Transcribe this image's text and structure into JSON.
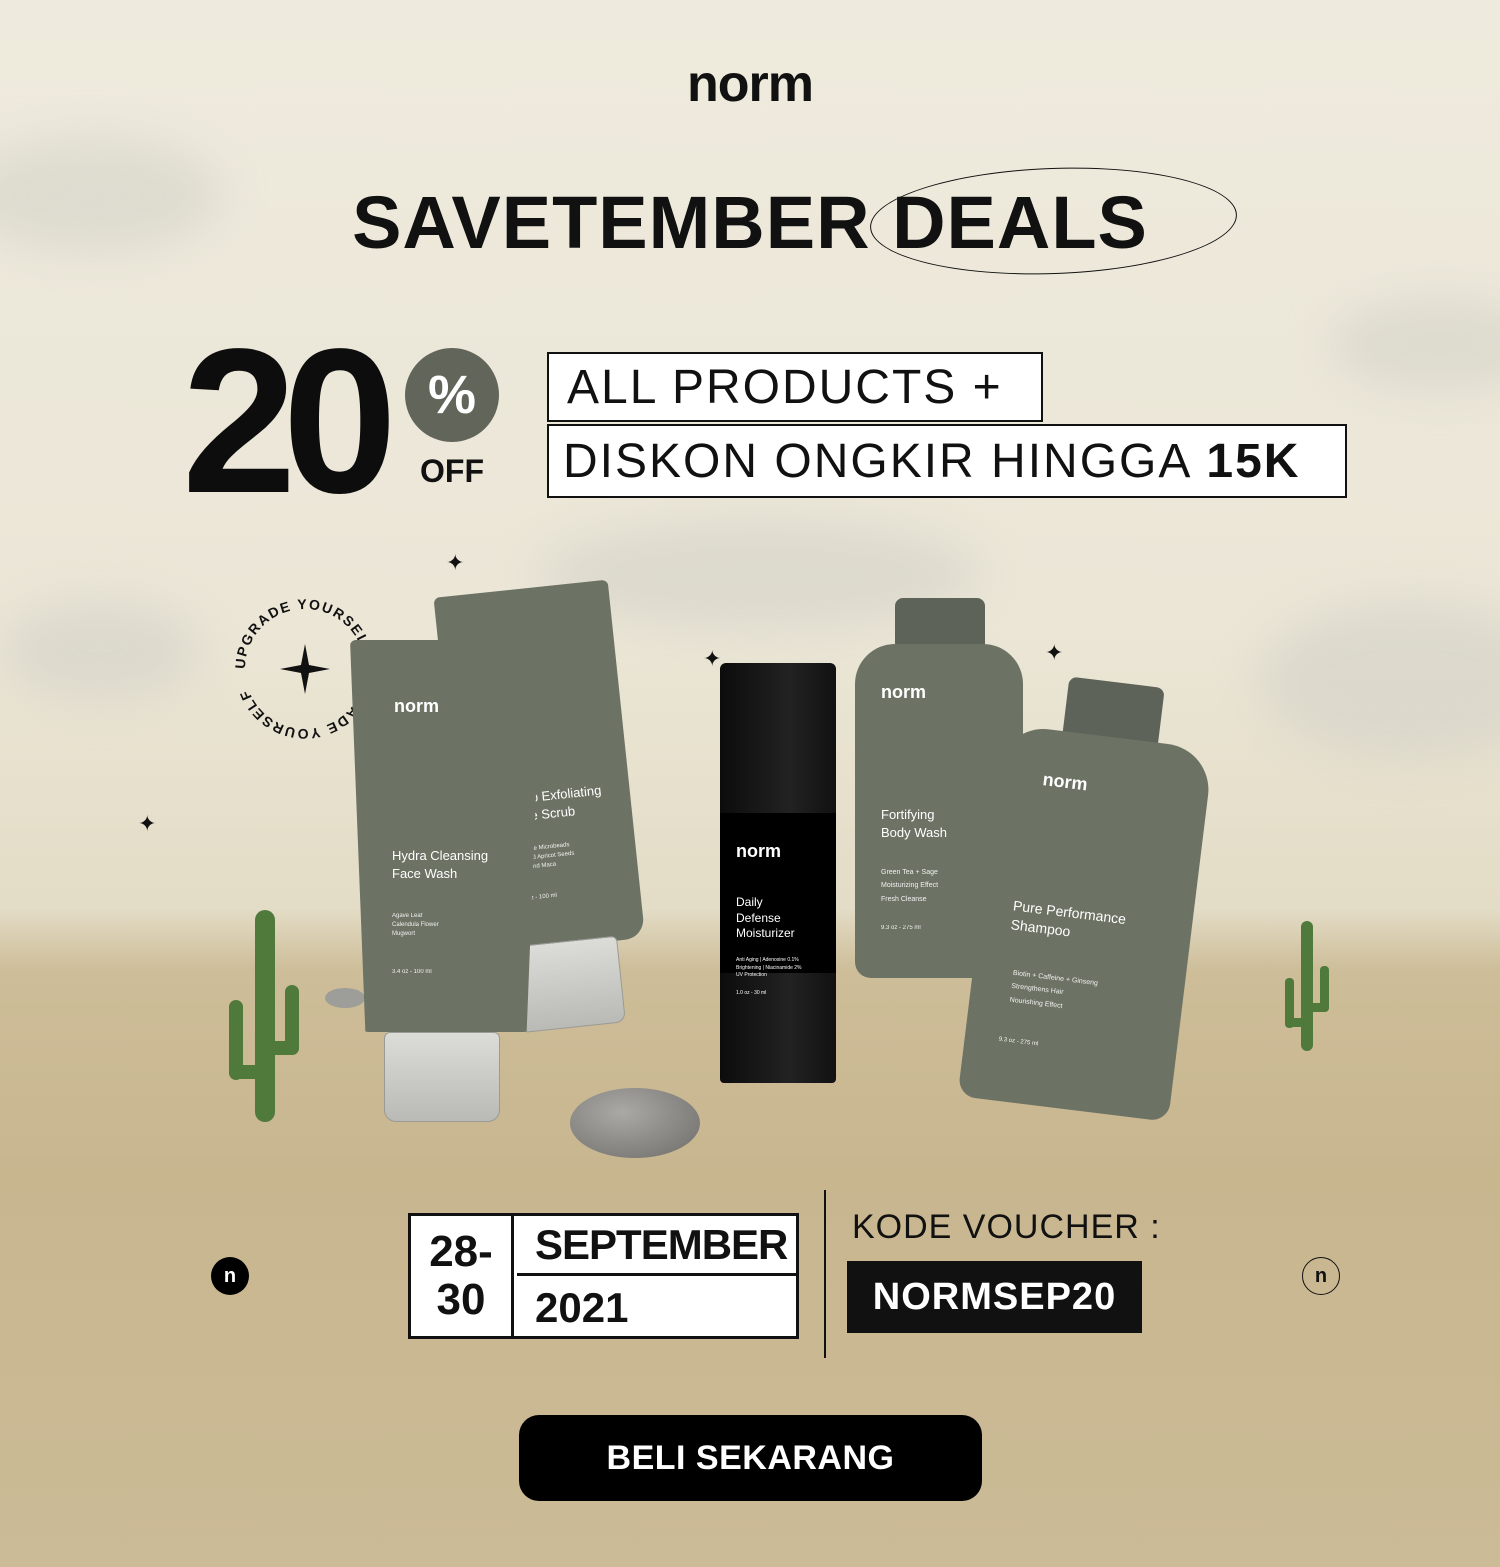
{
  "brand": {
    "logo": "norm"
  },
  "headline": "SAVETEMBER DEALS",
  "discount": {
    "number": "20",
    "percent": "%",
    "off": "OFF"
  },
  "offer": {
    "line1": "ALL PRODUCTS +",
    "line2_text": "DISKON ONGKIR HINGGA",
    "line2_bold": "15K"
  },
  "stamp": {
    "text": "UPGRADE YOURSELF  UPGRADE YOURSELF  "
  },
  "products": {
    "face_wash": {
      "brand": "norm",
      "name": "Hydra Cleansing\nFace Wash",
      "ingredients": "Agave Leaf\nCalendula Flower\nMugwort",
      "size": "3.4 oz - 100 ml"
    },
    "face_scrub": {
      "brand": "norm",
      "name": "Deep Exfoliating\nFace Scrub",
      "ingredients": "Cellulose Microbeads\nCrushed Apricot Seeds\nSage and Maca",
      "size": "3.4 oz - 100 ml"
    },
    "moisturizer": {
      "brand": "norm",
      "name": "Daily\nDefense\nMoisturizer",
      "ingredients": "Anti Aging | Adenosine 0.1%\nBrightening | Niacinamide 2%\nUV Protection",
      "size": "1.0 oz - 30 ml"
    },
    "body_wash": {
      "brand": "norm",
      "name": "Fortifying\nBody Wash",
      "ingredients": "Green Tea + Sage\nMoisturizing Effect\nFresh Cleanse",
      "size": "9.3 oz - 275 ml"
    },
    "shampoo": {
      "brand": "norm",
      "name": "Pure Performance\nShampoo",
      "ingredients": "Biotin + Caffeine + Ginseng\nStrengthens Hair\nNourishing Effect",
      "size": "9.3 oz - 275 ml"
    }
  },
  "date": {
    "days": "28-\n30",
    "month": "SEPTEMBER",
    "year": "2021"
  },
  "voucher": {
    "label": "KODE VOUCHER :",
    "code": "NORMSEP20"
  },
  "badges": {
    "left": "n",
    "right": "n"
  },
  "cta": {
    "label": "BELI SEKARANG"
  },
  "colors": {
    "product_green": "#6c7264",
    "percent_badge": "#61655a",
    "ink": "#111111",
    "sand": "#c8b68f"
  }
}
